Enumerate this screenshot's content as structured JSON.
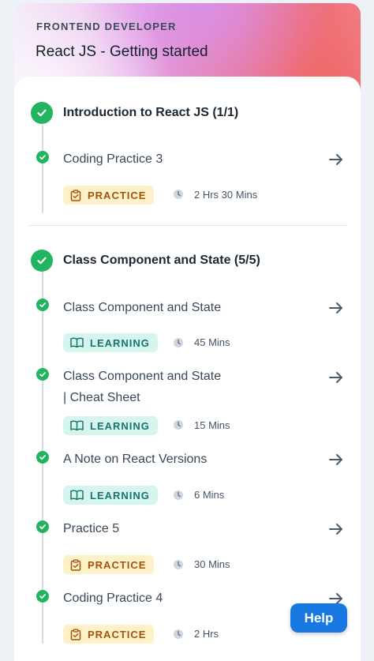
{
  "header": {
    "kicker": "FRONTEND DEVELOPER",
    "title": "React JS - Getting started"
  },
  "sections": [
    {
      "title": "Introduction to React JS (1/1)",
      "items": [
        {
          "title": "Coding Practice 3",
          "badge": "PRACTICE",
          "badge_icon": "clipboard-icon",
          "duration": "2 Hrs 30 Mins"
        }
      ]
    },
    {
      "title": "Class Component and State (5/5)",
      "items": [
        {
          "title": "Class Component and State",
          "badge": "LEARNING",
          "badge_icon": "book-icon",
          "duration": "45 Mins"
        },
        {
          "title_line1": "Class Component and State",
          "title_line2": "| Cheat Sheet",
          "badge": "LEARNING",
          "badge_icon": "book-icon",
          "duration": "15 Mins"
        },
        {
          "title": "A Note on React Versions",
          "badge": "LEARNING",
          "badge_icon": "book-icon",
          "duration": "6 Mins"
        },
        {
          "title": "Practice 5",
          "badge": "PRACTICE",
          "badge_icon": "clipboard-icon",
          "duration": "30 Mins"
        },
        {
          "title": "Coding Practice 4",
          "badge": "PRACTICE",
          "badge_icon": "clipboard-icon",
          "duration": "2 Hrs"
        }
      ]
    }
  ],
  "help_label": "Help",
  "colors": {
    "complete": "#22b45e",
    "practice_bg": "#fdf1c7",
    "practice_text": "#a4520f",
    "learning_bg": "#d6f5ef",
    "learning_text": "#17746b",
    "help_button": "#1877e0"
  }
}
